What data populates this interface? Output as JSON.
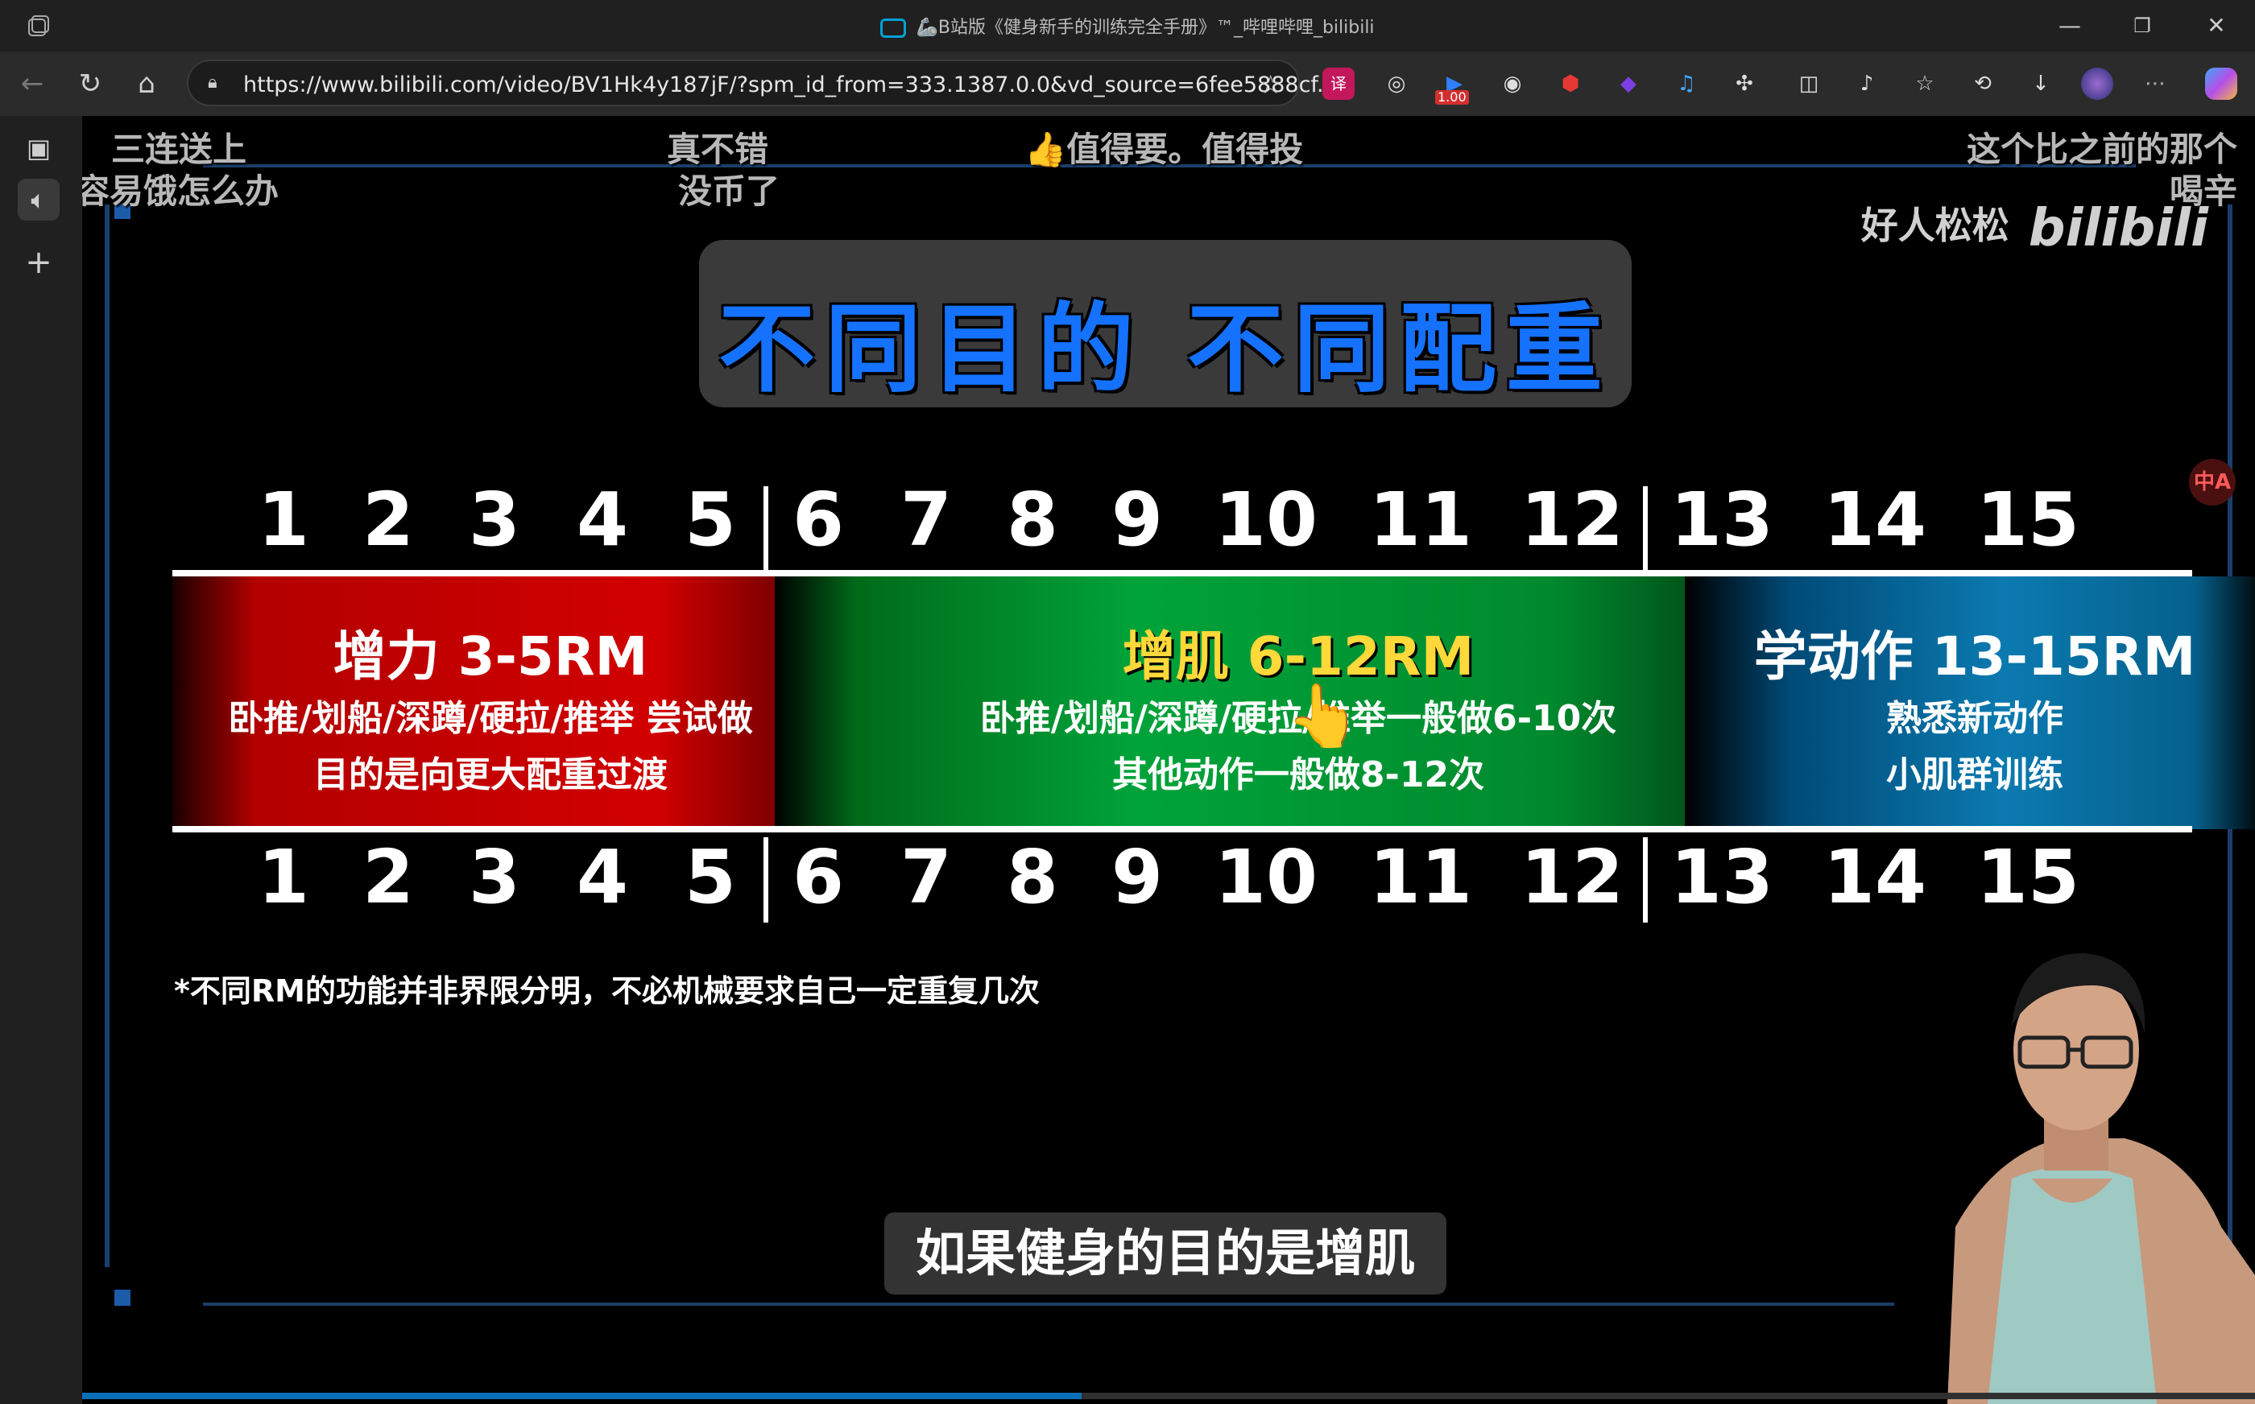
{
  "window": {
    "title": "🦾B站版《健身新手的训练完全手册》™_哔哩哔哩_bilibili",
    "minimize": "—",
    "restore": "❐",
    "close": "✕"
  },
  "toolbar": {
    "url": "https://www.bilibili.com/video/BV1Hk4y187jF/?spm_id_from=333.1387.0.0&vd_source=6fee5888cf...",
    "speed_badge": "1.00",
    "icons": [
      "back-icon",
      "reload-icon",
      "home-icon",
      "lock-icon",
      "star-icon",
      "translate-ext-icon",
      "glasses-ext-icon",
      "video-speed-ext-icon",
      "spy-ext-icon",
      "ublock-ext-icon",
      "cube-ext-icon",
      "music-ext-icon",
      "puzzle-icon",
      "split-screen-icon",
      "media-control-icon",
      "favorites-icon",
      "history-icon",
      "download-icon",
      "profile-avatar",
      "copilot-icon"
    ]
  },
  "sidebar": {
    "items": [
      "tab-icon",
      "speaker-icon",
      "add-icon"
    ]
  },
  "danmaku": [
    {
      "text": "三连送上"
    },
    {
      "text": "容易饿怎么办"
    },
    {
      "text": "真不错"
    },
    {
      "text": "没币了"
    },
    {
      "text": "👍值得要。值得投"
    },
    {
      "text": "这个比之前的那个"
    },
    {
      "text": "喝辛"
    }
  ],
  "watermark": {
    "author": "好人松松",
    "logo": "bilibili"
  },
  "headline": "不同目的  不同配重",
  "scale": {
    "numbers": [
      "1",
      "2",
      "3",
      "4",
      "5",
      "6",
      "7",
      "8",
      "9",
      "10",
      "11",
      "12",
      "13",
      "14",
      "15"
    ]
  },
  "bands": {
    "strength": {
      "title": "增力 3-5RM",
      "line1": "卧推/划船/深蹲/硬拉/推举 尝试做",
      "line2": "目的是向更大配重过渡",
      "color": "#d10000"
    },
    "hypertrophy": {
      "title": "增肌 6-12RM",
      "line1": "卧推/划船/深蹲/硬拉/推举一般做6-10次",
      "line2": "其他动作一般做8-12次",
      "color": "#00a33a",
      "title_color": "#ffd83a"
    },
    "learning": {
      "title": "学动作 13-15RM",
      "line1": "熟悉新动作",
      "line2": "小肌群训练",
      "color": "#0b7ab0"
    }
  },
  "footnote": "*不同RM的功能并非界限分明，不必机械要求自己一定重复几次",
  "subtitle": "如果健身的目的是增肌",
  "translate_badge": "中A",
  "playback": {
    "progress": 0.46
  }
}
